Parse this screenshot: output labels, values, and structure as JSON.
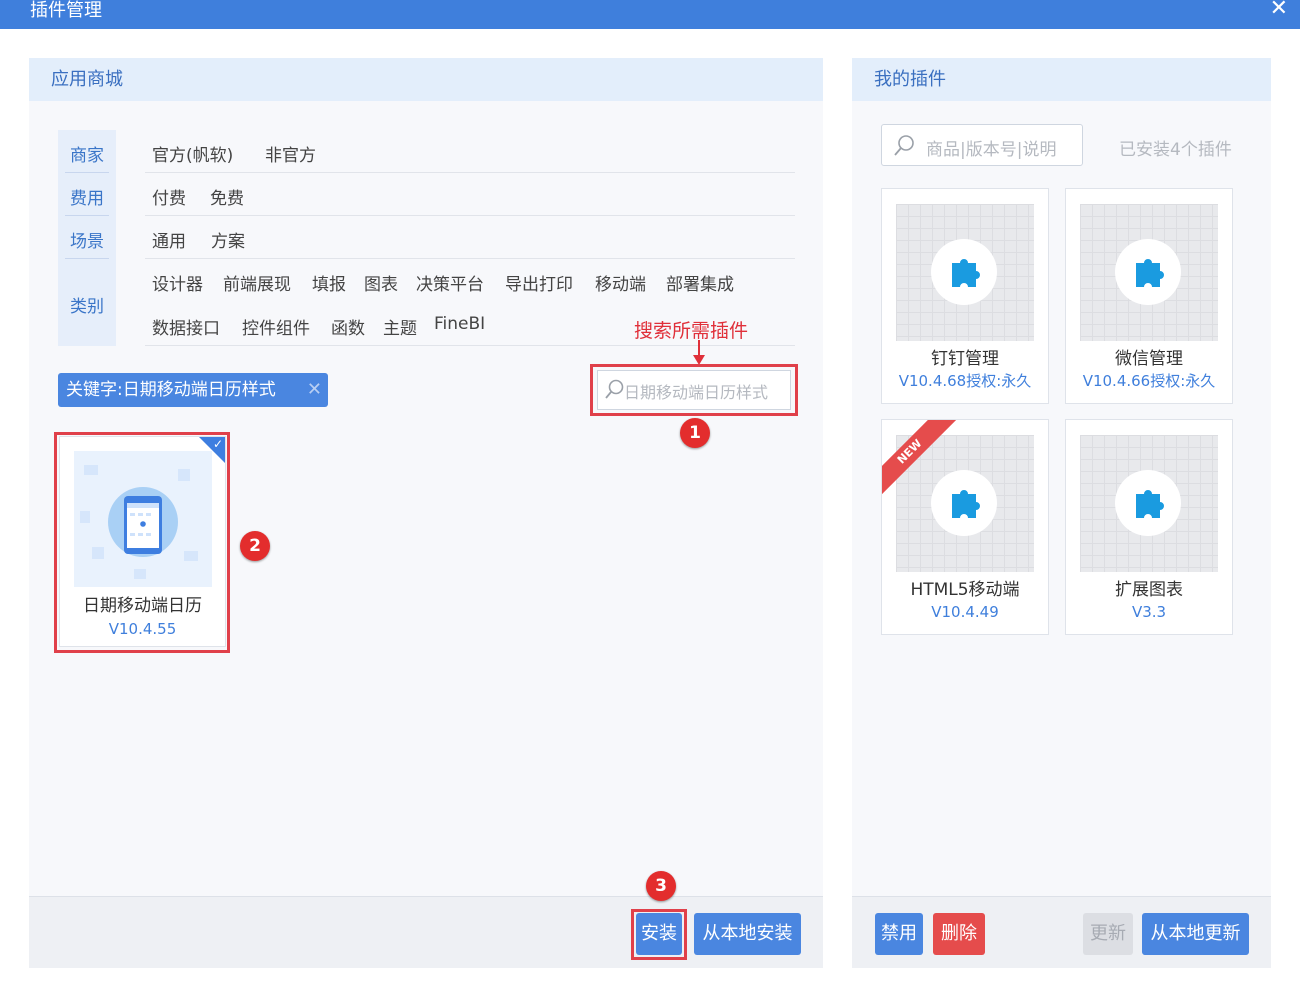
{
  "window": {
    "title": "插件管理",
    "close_label": "✕"
  },
  "store": {
    "header": "应用商城",
    "filters": {
      "merchant": {
        "label": "商家",
        "options": [
          "官方(帆软)",
          "非官方"
        ]
      },
      "cost": {
        "label": "费用",
        "options": [
          "付费",
          "免费"
        ]
      },
      "scene": {
        "label": "场景",
        "options": [
          "通用",
          "方案"
        ]
      },
      "category": {
        "label": "类别",
        "options_row1": [
          "设计器",
          "前端展现",
          "填报",
          "图表",
          "决策平台",
          "导出打印",
          "移动端",
          "部署集成"
        ],
        "options_row2": [
          "数据接口",
          "控件组件",
          "函数",
          "主题",
          "FineBI"
        ]
      }
    },
    "keyword_tag": "关键字:日期移动端日历样式",
    "keyword_clear": "✕",
    "search_value": "日期移动端日历样式",
    "annotation": "搜索所需插件",
    "steps": [
      "1",
      "2",
      "3"
    ],
    "plugin": {
      "name": "日期移动端日历",
      "version": "V10.4.55"
    },
    "buttons": {
      "install": "安装",
      "install_local": "从本地安装"
    }
  },
  "my_plugins": {
    "header": "我的插件",
    "search_placeholder": "商品|版本号|说明",
    "installed_count": "已安装4个插件",
    "items": [
      {
        "name": "钉钉管理",
        "version": "V10.4.68授权:永久"
      },
      {
        "name": "微信管理",
        "version": "V10.4.66授权:永久"
      },
      {
        "name": "HTML5移动端",
        "version": "V10.4.49",
        "ribbon": "NEW"
      },
      {
        "name": "扩展图表",
        "version": "V3.3"
      }
    ],
    "buttons": {
      "disable": "禁用",
      "delete": "删除",
      "update": "更新",
      "update_local": "从本地更新"
    }
  },
  "colors": {
    "accent": "#3f7fdc",
    "button_blue": "#4a86e0",
    "danger": "#e54c4c",
    "highlight": "#e0404a",
    "icon": "#1a9be0"
  }
}
